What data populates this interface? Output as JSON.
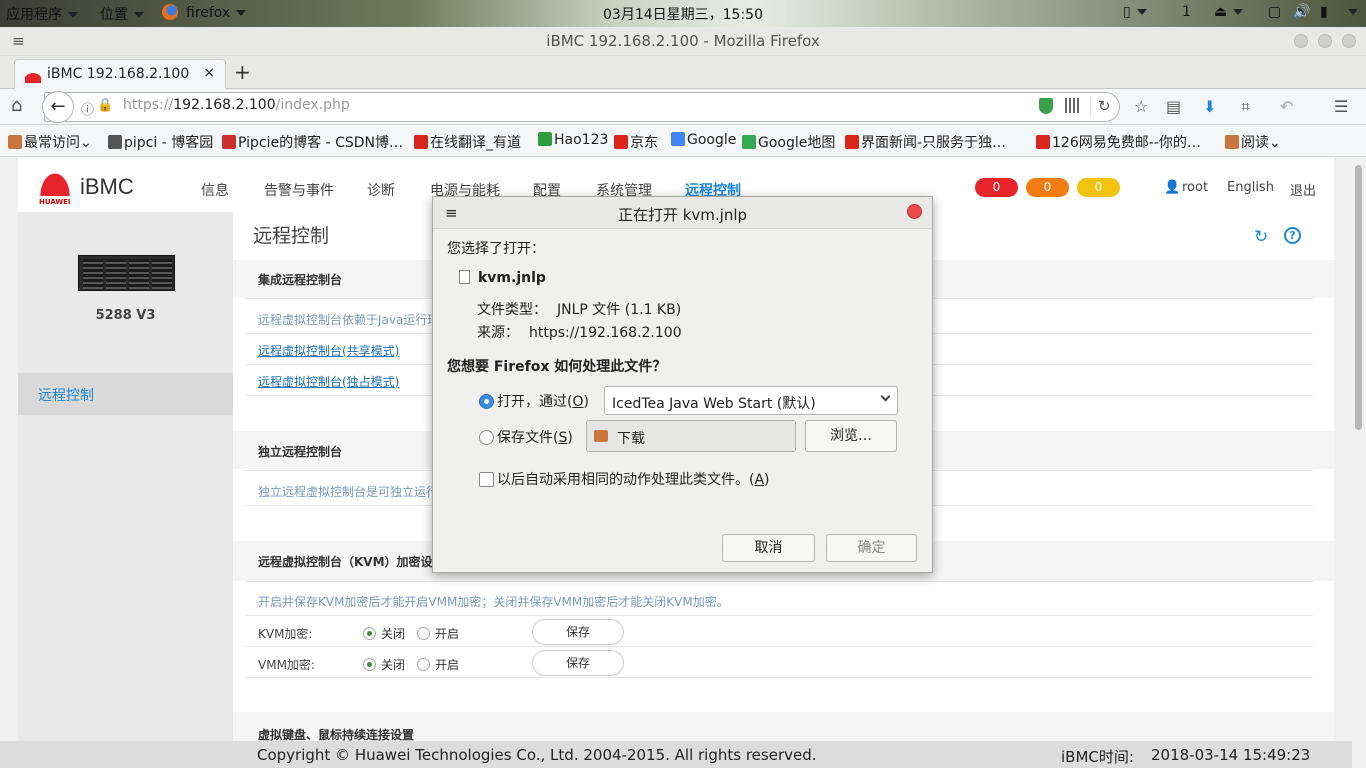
{
  "gnome": {
    "apps_menu": "应用程序",
    "places_menu": "位置",
    "active_app": "firefox",
    "clock": "03月14日星期三，15:50",
    "tray_count": "1"
  },
  "window": {
    "title": "iBMC 192.168.2.100 - Mozilla Firefox"
  },
  "tabs": [
    {
      "label": "iBMC 192.168.2.100"
    }
  ],
  "url": {
    "scheme": "https://",
    "host": "192.168.2.100",
    "path": "/index.php"
  },
  "bookmarks": [
    {
      "label": "最常访问",
      "color": "#c8763b"
    },
    {
      "label": "pipci - 博客园",
      "color": "#555555"
    },
    {
      "label": "Pipcie的博客 - CSDN博…",
      "color": "#c9302c"
    },
    {
      "label": "在线翻译_有道",
      "color": "#d9261c"
    },
    {
      "label": "Hao123",
      "color": "#2e9e3e"
    },
    {
      "label": "京东",
      "color": "#d9261c"
    },
    {
      "label": "Google",
      "color": "#4285f4"
    },
    {
      "label": "Google地图",
      "color": "#34a853"
    },
    {
      "label": "界面新闻-只服务于独…",
      "color": "#d9261c"
    },
    {
      "label": "126网易免费邮--你的…",
      "color": "#d9261c"
    },
    {
      "label": "阅读",
      "color": "#c8763b"
    }
  ],
  "ibmc": {
    "logo": "iBMC",
    "brand": "HUAWEI",
    "menu": [
      "信息",
      "告警与事件",
      "诊断",
      "电源与能耗",
      "配置",
      "系统管理",
      "远程控制"
    ],
    "alarms": [
      {
        "count": "0",
        "color": "#e8232a"
      },
      {
        "count": "0",
        "color": "#f07c13"
      },
      {
        "count": "0",
        "color": "#f2c40f"
      }
    ],
    "user": "root",
    "language": "English",
    "logout": "退出",
    "server_model": "5288 V3",
    "sidebar_item": "远程控制",
    "page_title": "远程控制",
    "sections": {
      "integrated_title": "集成远程控制台",
      "integrated_desc": "远程虚拟控制台依赖于Java运行环",
      "link_shared": "远程虚拟控制台(共享模式)",
      "link_exclusive": "远程虚拟控制台(独占模式)",
      "standalone_title": "独立远程控制台",
      "standalone_desc": "独立远程虚拟控制台是可独立运行",
      "kvm_title": "远程虚拟控制台（KVM）加密设置",
      "kvm_desc": "开启并保存KVM加密后才能开启VMM加密；关闭并保存VMM加密后才能关闭KVM加密。",
      "kvm_label": "KVM加密:",
      "vmm_label": "VMM加密:",
      "off": "关闭",
      "on": "开启",
      "save": "保存",
      "keyboard_title": "虚拟键盘、鼠标持续连接设置"
    },
    "footer_copyright": "Copyright © Huawei Technologies Co., Ltd. 2004-2015. All rights reserved.",
    "footer_time_label": "iBMC时间:",
    "footer_time": "2018-03-14 15:49:23"
  },
  "dialog": {
    "title": "正在打开 kvm.jnlp",
    "chosen": "您选择了打开：",
    "filename": "kvm.jnlp",
    "type_label": "文件类型：",
    "type_value": "JNLP 文件 (1.1 KB)",
    "source_label": "来源：",
    "source_value": "https://192.168.2.100",
    "question": "您想要 Firefox 如何处理此文件？",
    "open_with": "打开，通过(",
    "open_key": "O",
    "app_selected": "IcedTea Java Web Start (默认)",
    "save_file": "保存文件(",
    "save_key": "S",
    "folder": "下载",
    "browse": "浏览…",
    "remember": "以后自动采用相同的动作处理此类文件。(",
    "remember_key": "A",
    "cancel": "取消",
    "ok": "确定"
  }
}
